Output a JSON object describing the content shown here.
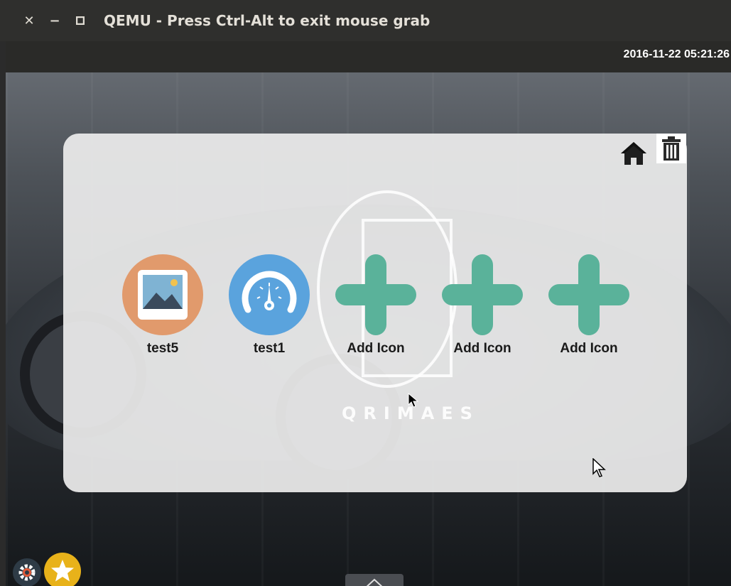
{
  "window": {
    "title": "QEMU - Press Ctrl-Alt to exit mouse grab",
    "close_glyph": "✕",
    "minimize_glyph": "−",
    "maximize_glyph": "□"
  },
  "topbar": {
    "clock": "2016-11-22 05:21:26"
  },
  "panel": {
    "logo_text": "QRIMAES",
    "apps": [
      {
        "label": "test5",
        "icon": "image-icon"
      },
      {
        "label": "test1",
        "icon": "speedometer-icon"
      },
      {
        "label": "Add Icon",
        "icon": "plus-icon"
      },
      {
        "label": "Add Icon",
        "icon": "plus-icon"
      },
      {
        "label": "Add Icon",
        "icon": "plus-icon"
      }
    ]
  },
  "colors": {
    "accent_green": "#5ab29a",
    "orange": "#e19a6c",
    "blue": "#5aa3dd",
    "star": "#e8b21a"
  }
}
